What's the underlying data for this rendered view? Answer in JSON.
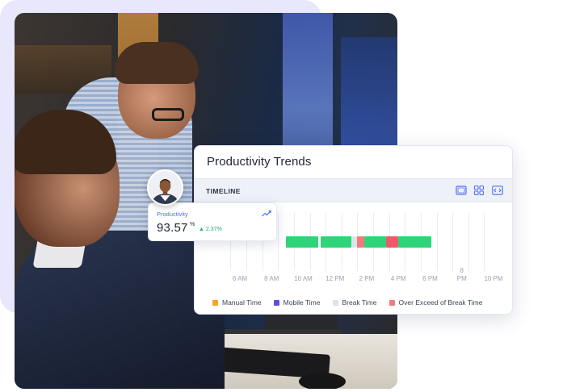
{
  "panel": {
    "title": "Productivity Trends",
    "bar_label": "TIMELINE",
    "icons": [
      "screen-icon",
      "grid-icon",
      "code-icon"
    ]
  },
  "timeline": {
    "ticks": [
      "6 AM",
      "8 AM",
      "10 AM",
      "12 PM",
      "2 PM",
      "4 PM",
      "6 PM",
      "8\nPM",
      "10 PM"
    ],
    "segments": [
      {
        "type": "manual",
        "color": "#2ed47a",
        "start": 0.0,
        "end": 0.22
      },
      {
        "type": "manual",
        "color": "#2ed47a",
        "start": 0.24,
        "end": 0.45
      },
      {
        "type": "break",
        "color": "#dfe3ea",
        "start": 0.45,
        "end": 0.49
      },
      {
        "type": "over-exceed",
        "color": "#ef7b7b",
        "start": 0.49,
        "end": 0.54
      },
      {
        "type": "manual",
        "color": "#2ed47a",
        "start": 0.54,
        "end": 0.69
      },
      {
        "type": "over-exceed",
        "color": "#ef5a6a",
        "start": 0.69,
        "end": 0.77
      },
      {
        "type": "manual",
        "color": "#2ed47a",
        "start": 0.77,
        "end": 1.0
      }
    ]
  },
  "legend": [
    {
      "label": "Manual Time",
      "color": "#f5a623"
    },
    {
      "label": "Mobile Time",
      "color": "#5b4fe0"
    },
    {
      "label": "Break Time",
      "color": "#dfe3ea"
    },
    {
      "label": "Over Exceed of Break Time",
      "color": "#ef7b7b"
    }
  ],
  "productivity": {
    "label": "Productivity",
    "value": "93.57",
    "unit": "%",
    "change": "▲ 2.37%",
    "change_color": "#1bb36b"
  },
  "colors": {
    "accent": "#4a6ff0",
    "panel_bar_bg": "#eef1f7",
    "blob": "#e9e7fb"
  }
}
